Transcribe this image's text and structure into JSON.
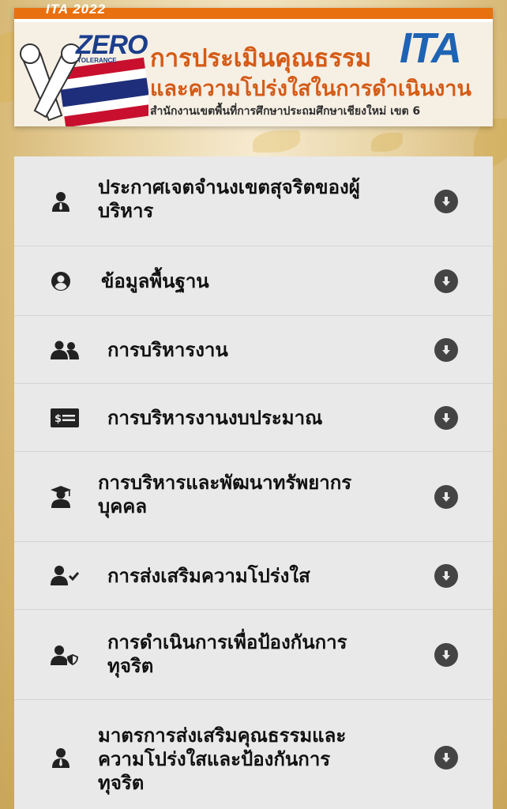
{
  "banner": {
    "year_tag": "ITA 2022",
    "zero_logo": "ZERO",
    "zero_sub": "TOLERANCE",
    "title_line1": "การประเมินคุณธรรม",
    "ita_logo": "ITA",
    "title_line2": "และความโปร่งใสในการดำเนินงาน",
    "subtitle": "สำนักงานเขตพื้นที่การศึกษาประถมศึกษาเชียงใหม่ เขต 6"
  },
  "menu": {
    "items": [
      {
        "label": "ประกาศเจตจำนงเขตสุจริตของผู้\nบริหาร",
        "icon": "user-tie-icon"
      },
      {
        "label": "ข้อมูลพื้นฐาน",
        "icon": "user-circle-icon"
      },
      {
        "label": "การบริหารงาน",
        "icon": "users-icon"
      },
      {
        "label": "การบริหารงานงบประมาณ",
        "icon": "money-card-icon"
      },
      {
        "label": "การบริหารและพัฒนาทรัพยากร\nบุคคล",
        "icon": "user-graduate-icon"
      },
      {
        "label": "การส่งเสริมความโปร่งใส",
        "icon": "user-check-icon"
      },
      {
        "label": "การดำเนินการเพื่อป้องกันการ\nทุจริต",
        "icon": "user-shield-icon"
      },
      {
        "label": "มาตรการส่งเสริมคุณธรรมและ\nความโปร่งใสและป้องกันการ\nทุจริต",
        "icon": "user-tie-icon"
      }
    ],
    "expand_icon": "arrow-circle-down-icon"
  },
  "colors": {
    "banner_orange": "#e8700f",
    "title_orange": "#d45b16",
    "ita_blue": "#1e63b4",
    "menu_bg": "#e9e9e9",
    "arrow_gray": "#444444"
  }
}
